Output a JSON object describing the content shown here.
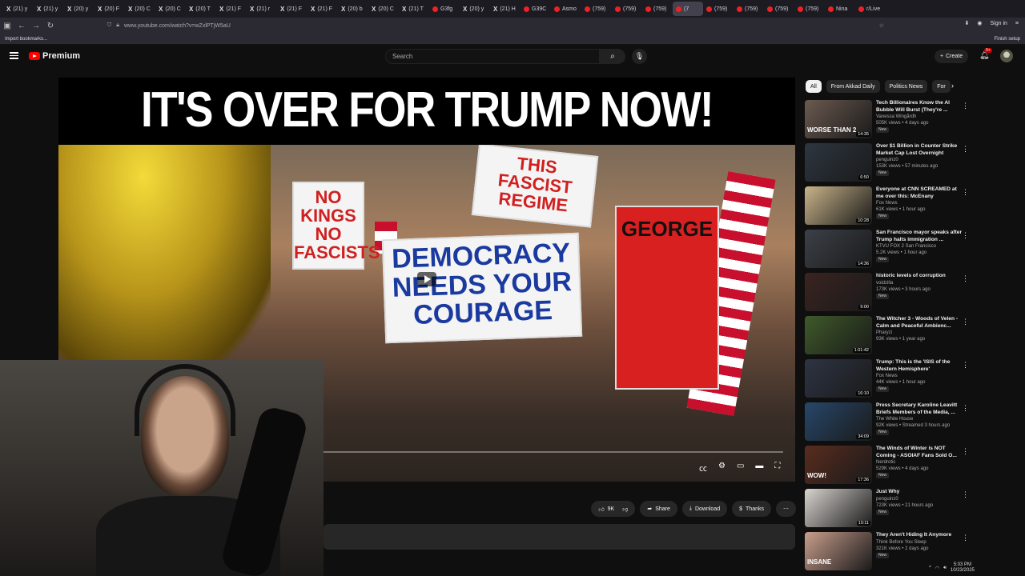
{
  "browser": {
    "tabs": [
      "(21) y",
      "(21) y",
      "(20) y",
      "(20) F",
      "(20) C",
      "(20) C",
      "(20) T",
      "(21) F",
      "(21) r",
      "(21) F",
      "(21) F",
      "(20) b",
      "(20) C",
      "(21) T",
      "G3fg",
      "(20) y",
      "(21) H",
      "G39C",
      "Asmo",
      "(759)",
      "(759)",
      "(759)",
      "(759)",
      "(759)",
      "(759)",
      "(759)",
      "Nina",
      "r/Live"
    ],
    "active_tab_label": "(7",
    "url": "www.youtube.com/watch?v=wZxlPTjW5aU",
    "bookmark_import": "Import bookmarks...",
    "sign_in": "Sign in",
    "finish_setup": "Finish setup"
  },
  "header": {
    "brand": "Premium",
    "search_placeholder": "Search",
    "create_label": "Create",
    "notif_badge": "9+"
  },
  "video": {
    "thumbnail_title": "IT'S OVER FOR TRUMP NOW!",
    "signs": {
      "democracy": "DEMOCRACY NEEDS YOUR COURAGE",
      "fascist": "THIS FASCIST REGIME",
      "no_kings": "NO KINGS NO FASCISTS",
      "george": "GEORGE"
    }
  },
  "actions": {
    "likes": "9K",
    "share": "Share",
    "download": "Download",
    "thanks": "Thanks"
  },
  "chips": [
    "All",
    "From Akkad Daily",
    "Politics News",
    "For"
  ],
  "recommendations": [
    {
      "title": "Tech Billionaires Know the AI Bubble Will Burst (They're ...",
      "channel": "Vanessa Wingårdh",
      "meta": "505K views • 4 days ago",
      "badge": "New",
      "duration": "14:35",
      "overlay": "WORSE THAN 2",
      "color": "#6b5a50"
    },
    {
      "title": "Over $1 Billion in Counter Strike Market Cap Lost Overnight",
      "channel": "penguinz0",
      "meta": "153K views • 57 minutes ago",
      "badge": "New",
      "duration": "6:50",
      "overlay": "",
      "color": "#2d3640"
    },
    {
      "title": "Everyone at CNN SCREAMED at me over this: McEnany",
      "channel": "Fox News",
      "meta": "61K views • 1 hour ago",
      "badge": "New",
      "duration": "10:28",
      "overlay": "",
      "color": "#c9b48a"
    },
    {
      "title": "San Francisco mayor speaks after Trump halts immigration ...",
      "channel": "KTVU FOX 2 San Francisco",
      "meta": "5.2K views • 1 hour ago",
      "badge": "New",
      "duration": "14:36",
      "overlay": "",
      "color": "#3c4048"
    },
    {
      "title": "historic levels of corruption",
      "channel": "voidzilla",
      "meta": "173K views • 3 hours ago",
      "badge": "New",
      "duration": "9:00",
      "overlay": "",
      "color": "#3a2420"
    },
    {
      "title": "The Witcher 3 - Woods of Velen - Calm and Peaceful Ambienc...",
      "channel": "Pharyzi",
      "meta": "93K views • 1 year ago",
      "badge": "",
      "duration": "1:01:42",
      "overlay": "",
      "color": "#3f5a2a"
    },
    {
      "title": "Trump: This is the 'ISIS of the Western Hemisphere'",
      "channel": "Fox News",
      "meta": "44K views • 1 hour ago",
      "badge": "New",
      "duration": "16:10",
      "overlay": "",
      "color": "#2e3444"
    },
    {
      "title": "Press Secretary Karoline Leavitt Briefs Members of the Media, ...",
      "channel": "The White House",
      "meta": "92K views • Streamed 3 hours ago",
      "badge": "New",
      "duration": "34:09",
      "overlay": "",
      "color": "#27476a"
    },
    {
      "title": "The Winds of Winter is NOT Coming - ASOIAF Fans Sold O...",
      "channel": "Nerdrotic",
      "meta": "529K views • 4 days ago",
      "badge": "New",
      "duration": "17:36",
      "overlay": "WOW!",
      "color": "#5a2c1e"
    },
    {
      "title": "Just Why",
      "channel": "penguinz0",
      "meta": "723K views • 21 hours ago",
      "badge": "New",
      "duration": "10:11",
      "overlay": "",
      "color": "#d8d4cf"
    },
    {
      "title": "They Aren't Hiding It Anymore",
      "channel": "Think Before You Sleep",
      "meta": "321K views • 2 days ago",
      "badge": "New",
      "duration": "",
      "overlay": "INSANE",
      "color": "#c89e8c"
    }
  ],
  "taskbar": {
    "time": "5:03 PM",
    "date": "10/23/2025"
  }
}
